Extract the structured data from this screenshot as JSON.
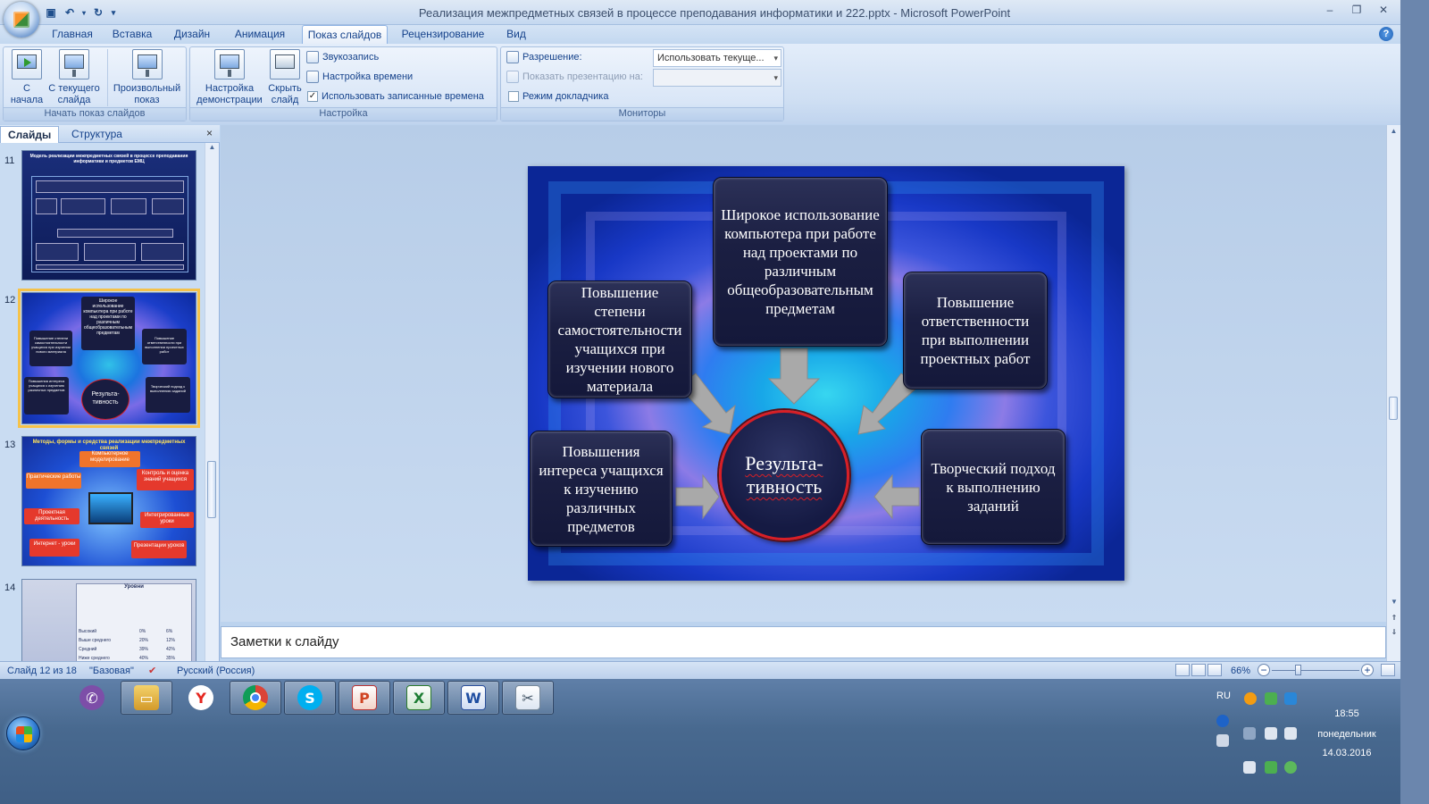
{
  "window": {
    "title": "Реализация межпредметных связей в процессе преподавания информатики и  222.pptx - Microsoft PowerPoint",
    "controls": [
      "‒",
      "❐",
      "✕"
    ]
  },
  "ribbon_tabs": [
    "Главная",
    "Вставка",
    "Дизайн",
    "Анимация",
    "Показ слайдов",
    "Рецензирование",
    "Вид"
  ],
  "active_tab": "Показ слайдов",
  "ribbon": {
    "start_group": {
      "label": "Начать показ слайдов",
      "from_start": "С\nначала",
      "from_current": "С текущего\nслайда",
      "custom": "Произвольный\nпоказ"
    },
    "setup_group": {
      "label": "Настройка",
      "setup_show": "Настройка\nдемонстрации",
      "hide_slide": "Скрыть\nслайд",
      "record_narration": "Звукозапись",
      "rehearse": "Настройка времени",
      "use_timings": "Использовать записанные времена",
      "use_timings_checked": true
    },
    "monitors_group": {
      "label": "Мониторы",
      "resolution_label": "Разрешение:",
      "resolution_value": "Использовать текуще...",
      "show_on_label": "Показать презентацию на:",
      "show_on_value": "",
      "presenter_view": "Режим докладчика",
      "presenter_view_checked": false
    }
  },
  "left_pane": {
    "tabs": [
      "Слайды",
      "Структура"
    ],
    "active": "Слайды",
    "close": "×",
    "thumbnails": [
      {
        "number": "11",
        "title": "Модель реализации межпредметных связей в процессе преподавания информатики и предметов ЕМЦ"
      },
      {
        "number": "12",
        "center": "Результа-\nтивность",
        "selected": true
      },
      {
        "number": "13",
        "title": "Методы, формы и средства реализации межпредметных связей",
        "items": [
          "Практические работы",
          "Компьютерное моделирование",
          "Контроль и оценка знаний учащихся",
          "Проектная деятельность",
          "Интегрированные уроки",
          "Интернет - уроки",
          "Презентации уроков"
        ]
      },
      {
        "number": "14",
        "table_header": "Уровни",
        "table_rows": [
          "Высокий",
          "Выше среднего",
          "Средний",
          "Ниже среднего"
        ],
        "table_values": [
          "0%",
          "6%",
          "20%",
          "12%",
          "39%",
          "42%",
          "40%",
          "35%"
        ]
      }
    ]
  },
  "slide": {
    "center": "Результа-\nтивность",
    "top": "Широкое использование компьютера при работе над проектами по различным общеобразовательным предметам",
    "upper_left": "Повышение степени самостоятельности учащихся при изучении нового материала",
    "upper_right": "Повышение ответственности при выполнении проектных работ",
    "lower_left": "Повышения интереса учащихся к изучению различных предметов",
    "lower_right": "Творческий подход к выполнению заданий"
  },
  "notes_placeholder": "Заметки к слайду",
  "status": {
    "slide_counter": "Слайд 12 из 18",
    "theme": "\"Базовая\"",
    "language": "Русский (Россия)",
    "zoom": "66%",
    "zoom_value": 66
  },
  "taskbar": {
    "apps": [
      "viber-icon",
      "file-manager-icon",
      "yandex-browser-icon",
      "chrome-icon",
      "skype-icon",
      "powerpoint-icon",
      "excel-icon",
      "word-icon",
      "paint-icon"
    ],
    "lang": "RU",
    "time": "18:55",
    "day": "понедельник",
    "date": "14.03.2016"
  },
  "colors": {
    "ribbon_bg": "#cfdff3",
    "slide_frame_blue": "#1437c8",
    "box_dark": "#1b1f42",
    "circle_border": "#d81f26",
    "taskbar": "#4a6b92"
  }
}
